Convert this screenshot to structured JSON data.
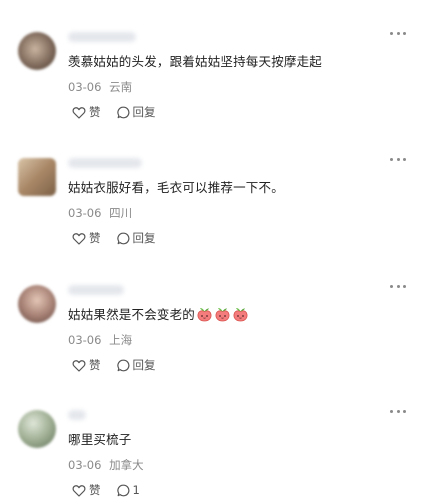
{
  "comments": [
    {
      "text": "羡慕姑姑的头发，跟着姑姑坚持每天按摩走起",
      "date": "03-06",
      "location": "云南",
      "like_label": "赞",
      "reply_label": "回复",
      "avatar_color": "#8d7a6a"
    },
    {
      "text": "姑姑衣服好看，毛衣可以推荐一下不。",
      "date": "03-06",
      "location": "四川",
      "like_label": "赞",
      "reply_label": "回复",
      "avatar_color": "#b99a7a"
    },
    {
      "text": "姑姑果然是不会变老的",
      "emoji": "peach-emoji",
      "emoji_count": 3,
      "date": "03-06",
      "location": "上海",
      "like_label": "赞",
      "reply_label": "回复",
      "avatar_color": "#a07e72"
    },
    {
      "text": "哪里买梳子",
      "date": "03-06",
      "location": "加拿大",
      "like_label": "赞",
      "reply_label": "1",
      "avatar_color": "#8f9f86"
    }
  ],
  "icons": {
    "like": "heart-outline-icon",
    "reply": "speech-bubble-icon",
    "more": "more-dots-icon"
  }
}
